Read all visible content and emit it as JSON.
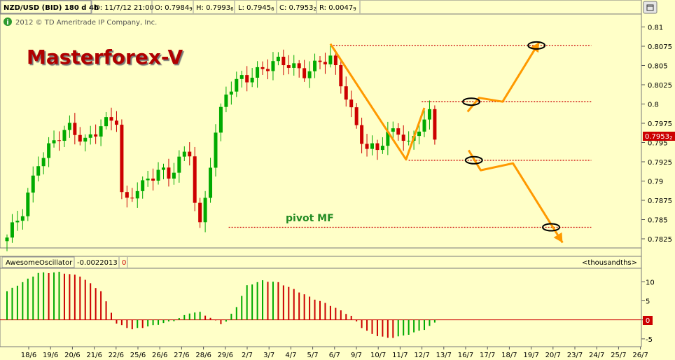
{
  "header": {
    "symbol": "NZD/USD (BID) 180 d 4h",
    "date": "D: 11/7/12 21:00",
    "open": "O: 0.7984",
    "open_sub": "9",
    "high": "H: 0.7993",
    "high_sub": "6",
    "low": "L: 0.7945",
    "low_sub": "6",
    "close": "C: 0.7953",
    "close_sub": "2",
    "range": "R: 0.0047",
    "range_sub": "9",
    "copyright": "2012 © TD Ameritrade IP Company, Inc."
  },
  "watermark": "Masterforex-V",
  "annotation": "pivot MF",
  "price_tag": {
    "main": "0.7953",
    "sub": "2"
  },
  "oscillator": {
    "name": "AwesomeOscillator",
    "value": "-0.0022013",
    "flag": "0",
    "units": "<thousandths>",
    "zero_tag": "0"
  },
  "colors": {
    "background": "#ffffc8",
    "up_candle": "#00aa00",
    "down_candle": "#cc0000",
    "projection": "#ff9900",
    "level": "#cc0000",
    "watermark": "#b00000",
    "annotation": "#228b22"
  },
  "chart_data": [
    {
      "type": "candlestick",
      "title": "NZD/USD (BID) 180 d 4h",
      "ylim": [
        0.7815,
        0.8115
      ],
      "y_ticks": [
        "0.81",
        "0.8075",
        "0.805",
        "0.8025",
        "0.8",
        "0.7975",
        "0.795",
        "0.7925",
        "0.79",
        "0.7875",
        "0.785",
        "0.7825"
      ],
      "x_ticks": [
        "18/6",
        "19/6",
        "20/6",
        "21/6",
        "22/6",
        "25/6",
        "26/6",
        "27/6",
        "28/6",
        "29/6",
        "2/7",
        "3/7",
        "4/7",
        "5/7",
        "6/7",
        "9/7",
        "10/7",
        "11/7",
        "12/7",
        "13/7",
        "16/7",
        "17/7",
        "18/7",
        "19/7",
        "20/7",
        "23/7",
        "24/7",
        "25/7",
        "26/7"
      ],
      "close_path": [
        [
          0,
          0.7822
        ],
        [
          3,
          0.786
        ],
        [
          6,
          0.793
        ],
        [
          9,
          0.795
        ],
        [
          12,
          0.7965
        ],
        [
          15,
          0.7955
        ],
        [
          18,
          0.7975
        ],
        [
          21,
          0.7975
        ],
        [
          21.3,
          0.7885
        ],
        [
          23,
          0.787
        ],
        [
          25,
          0.7895
        ],
        [
          27,
          0.7905
        ],
        [
          29,
          0.7915
        ],
        [
          31,
          0.79
        ],
        [
          33,
          0.7925
        ],
        [
          35,
          0.794
        ],
        [
          36,
          0.788
        ],
        [
          37,
          0.7845
        ],
        [
          38,
          0.788
        ],
        [
          39,
          0.7925
        ],
        [
          40,
          0.796
        ],
        [
          42,
          0.801
        ],
        [
          45,
          0.8035
        ],
        [
          48,
          0.8045
        ],
        [
          51,
          0.805
        ],
        [
          54,
          0.805
        ],
        [
          57,
          0.8045
        ],
        [
          60,
          0.8055
        ],
        [
          62,
          0.8055
        ],
        [
          63,
          0.804
        ],
        [
          65,
          0.801
        ],
        [
          67,
          0.7975
        ],
        [
          69,
          0.7945
        ],
        [
          71,
          0.794
        ],
        [
          73,
          0.7955
        ],
        [
          75,
          0.7965
        ],
        [
          77,
          0.795
        ],
        [
          79,
          0.7975
        ],
        [
          81,
          0.7985
        ],
        [
          82,
          0.7953
        ]
      ],
      "levels": [
        {
          "y": 0.8076,
          "x_start": 62,
          "x_end": 112
        },
        {
          "y": 0.8003,
          "x_start": 79.5,
          "x_end": 112
        },
        {
          "y": 0.7927,
          "x_start": 77,
          "x_end": 112
        },
        {
          "y": 0.784,
          "x_start": 42.5,
          "x_end": 112
        }
      ],
      "projections": [
        {
          "points": [
            [
              62,
              0.8078
            ],
            [
              76.5,
              0.7928
            ],
            [
              80,
              0.7995
            ]
          ]
        },
        {
          "points": [
            [
              88.3,
              0.799
            ],
            [
              90.5,
              0.8008
            ],
            [
              95,
              0.8003
            ],
            [
              102,
              0.808
            ]
          ],
          "arrow": true
        },
        {
          "points": [
            [
              88.5,
              0.794
            ],
            [
              90.8,
              0.7914
            ],
            [
              97,
              0.7923
            ],
            [
              106.5,
              0.782
            ]
          ],
          "arrow": true
        }
      ],
      "marked_points": [
        [
          101.5,
          0.8076
        ],
        [
          89,
          0.8003
        ],
        [
          89.5,
          0.7927
        ],
        [
          104.3,
          0.784
        ]
      ]
    },
    {
      "type": "bar",
      "title": "AwesomeOscillator",
      "ylim": [
        -6.5,
        13
      ],
      "y_ticks": [
        "10",
        "5",
        "0",
        "-5"
      ],
      "last_value": -0.0022013,
      "path": [
        [
          0,
          7.5
        ],
        [
          6,
          12.3
        ],
        [
          10,
          12.5
        ],
        [
          14,
          11.5
        ],
        [
          18,
          7.5
        ],
        [
          20,
          2.0
        ],
        [
          21,
          -1.0
        ],
        [
          24,
          -2.5
        ],
        [
          28,
          -1.5
        ],
        [
          32,
          -0.2
        ],
        [
          35,
          1.8
        ],
        [
          37,
          2.0
        ],
        [
          39,
          0.5
        ],
        [
          41,
          -1.0
        ],
        [
          42,
          -0.5
        ],
        [
          44,
          3.5
        ],
        [
          46,
          9.0
        ],
        [
          49,
          10.3
        ],
        [
          52,
          9.8
        ],
        [
          55,
          8.0
        ],
        [
          58,
          6.0
        ],
        [
          62,
          3.8
        ],
        [
          66,
          1.0
        ],
        [
          68,
          -2.0
        ],
        [
          70,
          -3.8
        ],
        [
          73,
          -4.8
        ],
        [
          76,
          -4.2
        ],
        [
          80,
          -2.5
        ],
        [
          82,
          -0.8
        ]
      ]
    }
  ]
}
